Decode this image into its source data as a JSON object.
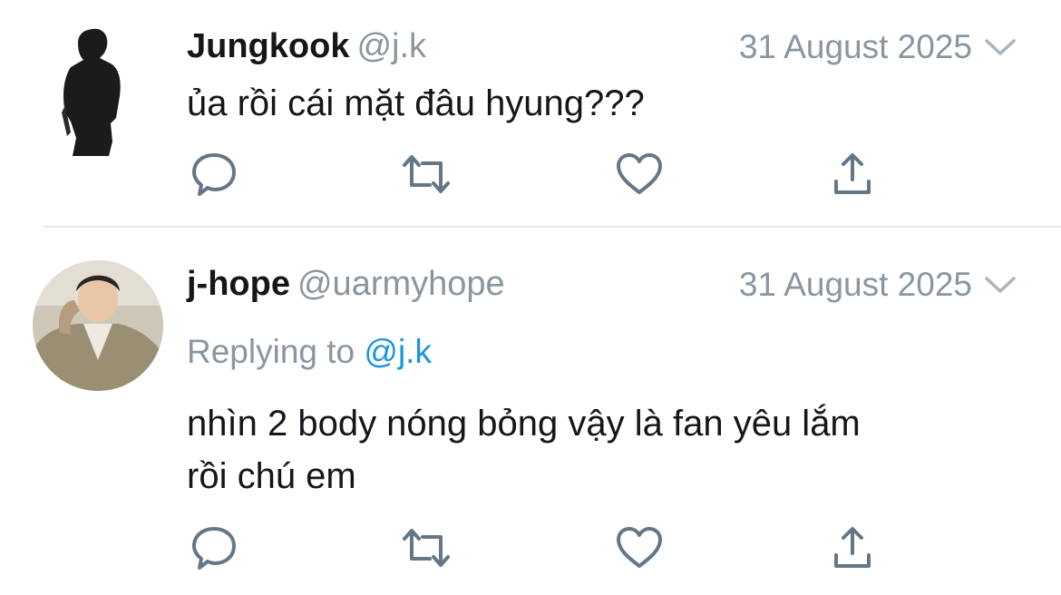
{
  "tweets": [
    {
      "name": "Jungkook",
      "handle": "@j.k",
      "date": "31 August 2025",
      "text": "ủa rồi cái mặt đâu hyung???"
    },
    {
      "name": "j-hope",
      "handle": "@uarmyhope",
      "date": "31 August 2025",
      "replying_prefix": "Replying to ",
      "replying_to": "@j.k",
      "text_line1": "nhìn 2 body nóng bỏng vậy là fan yêu lắm",
      "text_line2": "rồi chú em"
    }
  ],
  "icons": [
    "reply-icon",
    "retweet-icon",
    "like-icon",
    "share-icon",
    "chevron-down-icon"
  ],
  "colors": {
    "text": "#14171a",
    "secondary": "#8a969f",
    "link": "#1b95e0",
    "icon": "#657786",
    "divider": "#e1e6ea"
  }
}
